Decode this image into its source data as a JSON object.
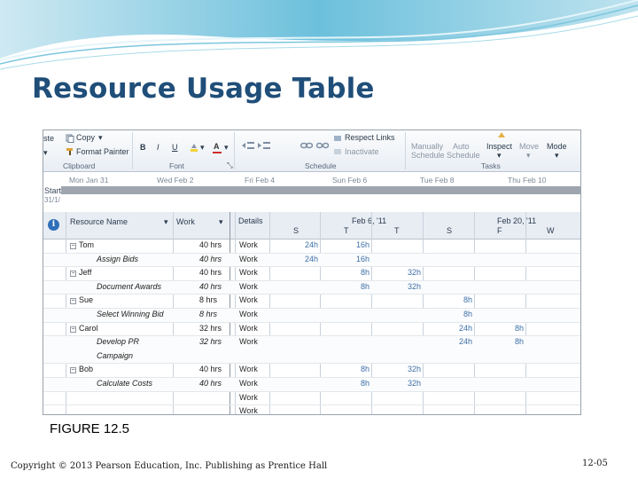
{
  "slide": {
    "title": "Resource Usage Table",
    "caption": "FIGURE 12.5",
    "footer": "Copyright © 2013 Pearson Education, Inc. Publishing as Prentice Hall",
    "page_number": "12-05"
  },
  "ribbon": {
    "paste_fragment": "ste",
    "copy": "Copy",
    "format_painter": "Format Painter",
    "clipboard_group": "Clipboard",
    "font_group": "Font",
    "respect_links": "Respect Links",
    "inactivate": "Inactivate",
    "schedule_group": "Schedule",
    "manually": "Manually",
    "manually2": "Schedule",
    "auto": "Auto",
    "auto2": "Schedule",
    "inspect": "Inspect",
    "move": "Move",
    "mode": "Mode",
    "tasks_group": "Tasks"
  },
  "timeline": {
    "dates": [
      "Mon Jan 31",
      "Wed Feb 2",
      "Fri Feb 4",
      "Sun Feb 6",
      "Tue Feb 8",
      "Thu Feb 10"
    ],
    "start_label": "Start",
    "start_date": "31/1/"
  },
  "table": {
    "resource_name_header": "Resource Name",
    "work_header": "Work",
    "details_header": "Details",
    "week1": "Feb 6, '11",
    "week2": "Feb 20, '11",
    "day_headers": [
      "S",
      "T",
      "T",
      "S",
      "F",
      "W"
    ],
    "rows": [
      {
        "name": "Tom",
        "work": "40 hrs",
        "detail": "Work",
        "vals": [
          "24h",
          "16h",
          "",
          "",
          "",
          ""
        ],
        "level": 0
      },
      {
        "name": "Assign Bids",
        "work": "40 hrs",
        "detail": "Work",
        "vals": [
          "24h",
          "16h",
          "",
          "",
          "",
          ""
        ],
        "level": 1
      },
      {
        "name": "Jeff",
        "work": "40 hrs",
        "detail": "Work",
        "vals": [
          "",
          "8h",
          "32h",
          "",
          "",
          ""
        ],
        "level": 0
      },
      {
        "name": "Document Awards",
        "work": "40 hrs",
        "detail": "Work",
        "vals": [
          "",
          "8h",
          "32h",
          "",
          "",
          ""
        ],
        "level": 1
      },
      {
        "name": "Sue",
        "work": "8 hrs",
        "detail": "Work",
        "vals": [
          "",
          "",
          "",
          "8h",
          "",
          ""
        ],
        "level": 0
      },
      {
        "name": "Select Winning Bid",
        "work": "8 hrs",
        "detail": "Work",
        "vals": [
          "",
          "",
          "",
          "8h",
          "",
          ""
        ],
        "level": 1
      },
      {
        "name": "Carol",
        "work": "32 hrs",
        "detail": "Work",
        "vals": [
          "",
          "",
          "",
          "24h",
          "8h",
          ""
        ],
        "level": 0
      },
      {
        "name": "Develop PR",
        "name2": "Campaign",
        "work": "32 hrs",
        "detail": "Work",
        "vals": [
          "",
          "",
          "",
          "24h",
          "8h",
          ""
        ],
        "level": 1
      },
      {
        "name": "Bob",
        "work": "40 hrs",
        "detail": "Work",
        "vals": [
          "",
          "8h",
          "32h",
          "",
          "",
          ""
        ],
        "level": 0
      },
      {
        "name": "Calculate Costs",
        "work": "40 hrs",
        "detail": "Work",
        "vals": [
          "",
          "8h",
          "32h",
          "",
          "",
          ""
        ],
        "level": 1
      },
      {
        "name": "",
        "work": "",
        "detail": "Work",
        "vals": [
          "",
          "",
          "",
          "",
          "",
          ""
        ],
        "level": 0
      },
      {
        "name": "",
        "work": "",
        "detail": "Work",
        "vals": [
          "",
          "",
          "",
          "",
          "",
          ""
        ],
        "level": 0
      }
    ]
  },
  "colors": {
    "title": "#1f4e79",
    "value_text": "#3d6fa8",
    "header_bg": "#e8edf4"
  }
}
